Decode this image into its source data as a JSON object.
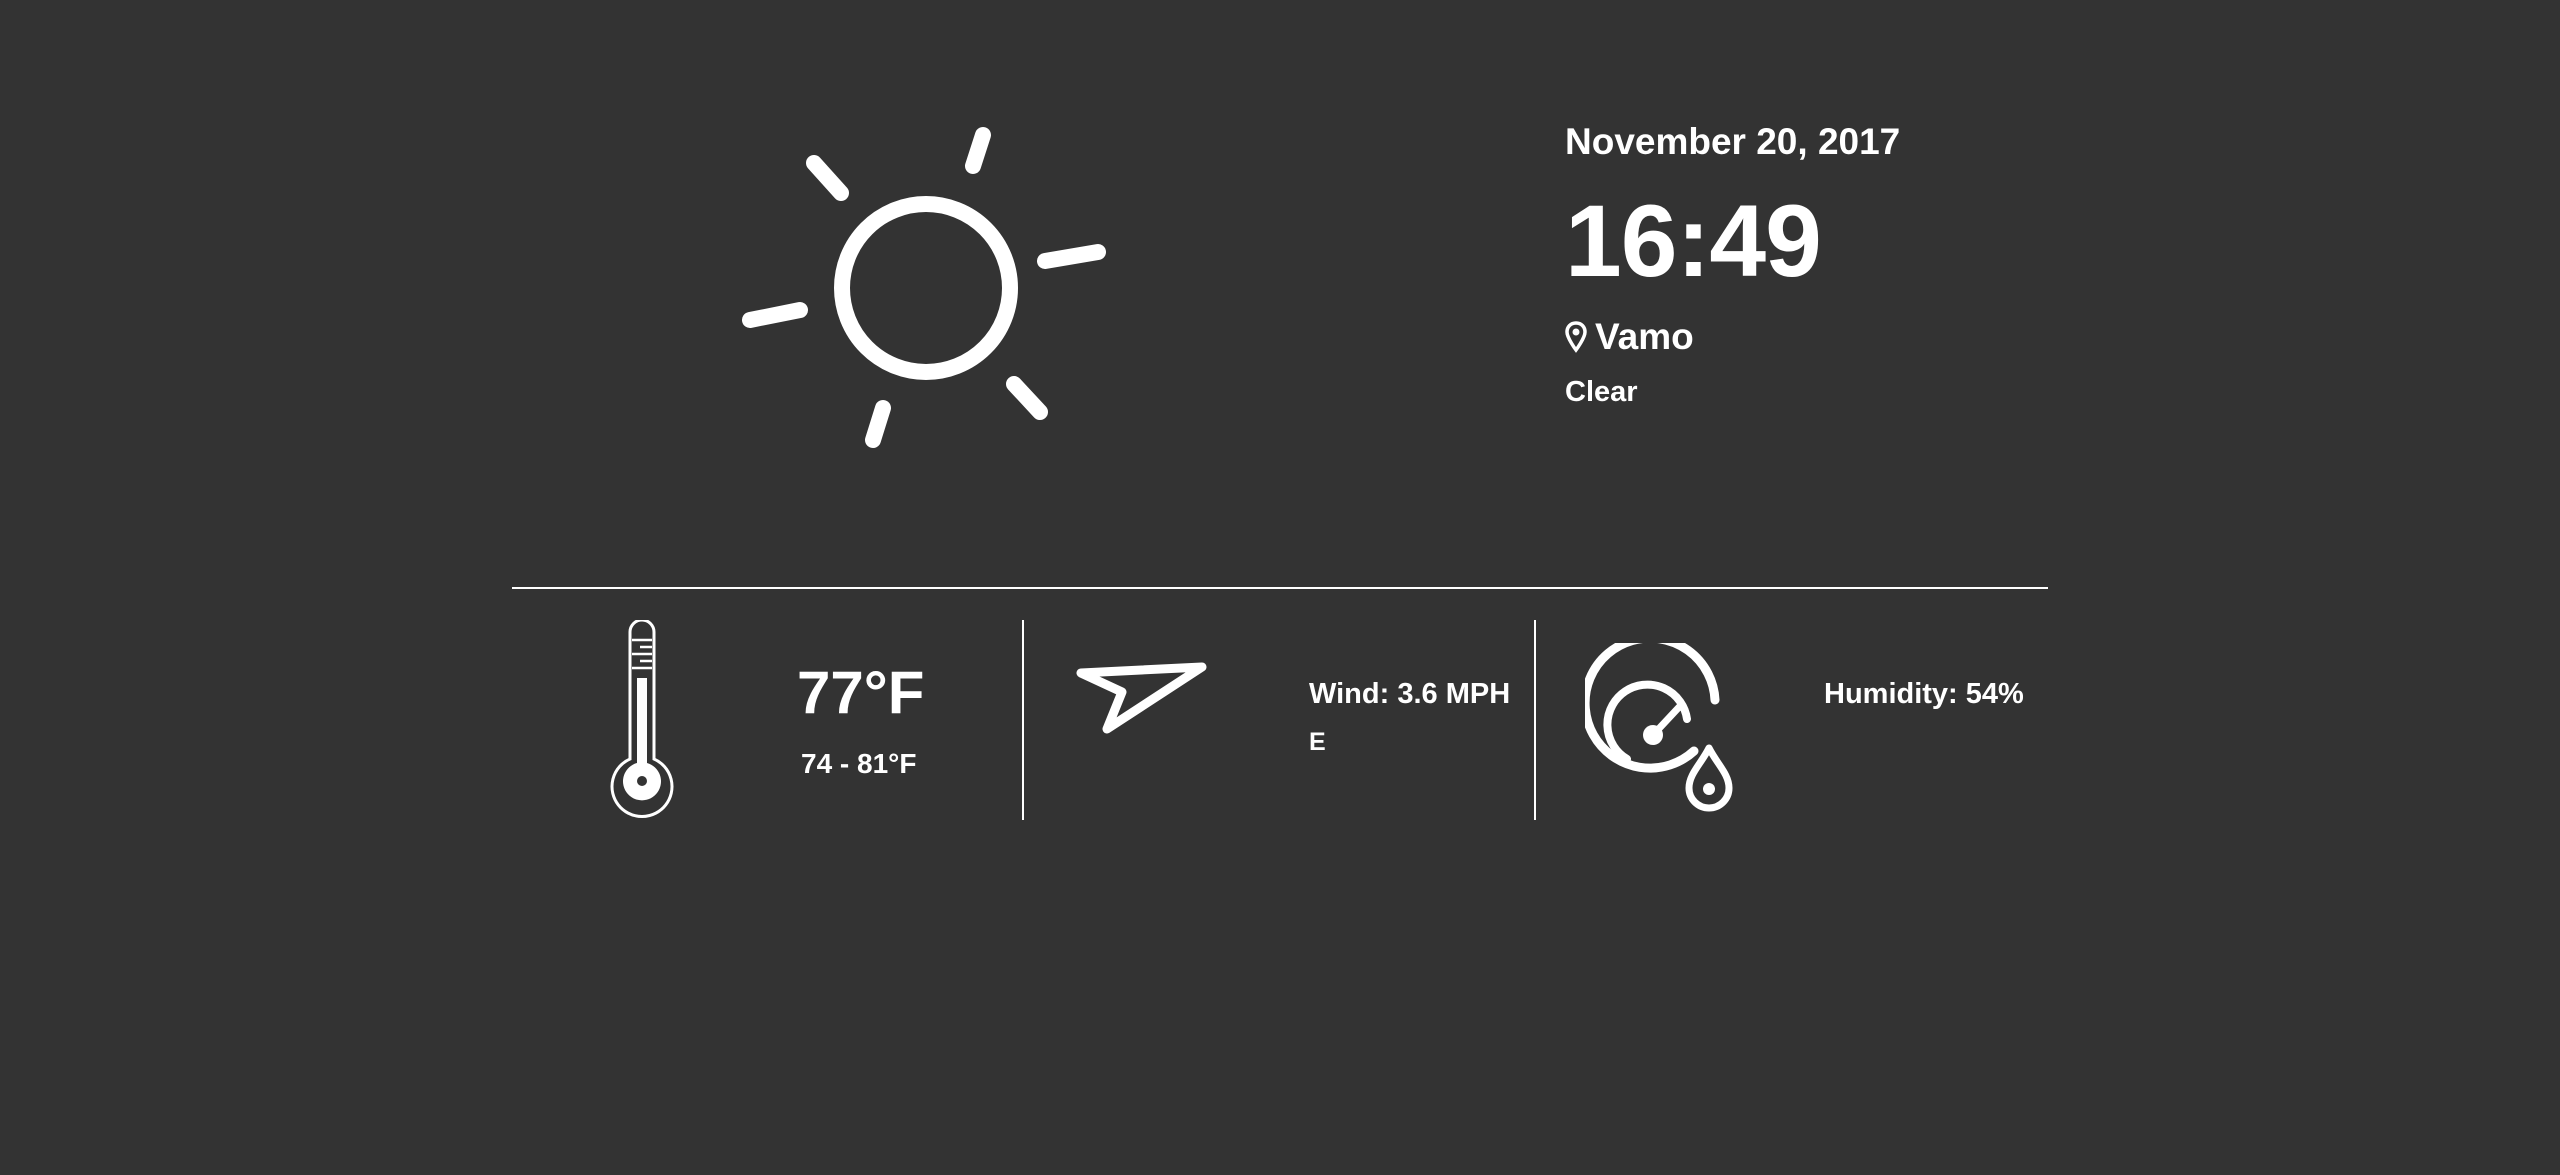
{
  "weather": {
    "icon": "sun-icon",
    "date": "November 20, 2017",
    "time": "16:49",
    "location": "Vamo",
    "condition": "Clear"
  },
  "stats": {
    "temperature": {
      "icon": "thermometer-icon",
      "current": "77°F",
      "range": "74 - 81°F"
    },
    "wind": {
      "icon": "wind-direction-icon",
      "speed": "Wind: 3.6 MPH",
      "direction": "E"
    },
    "humidity": {
      "icon": "humidity-gauge-icon",
      "value": "Humidity: 54%"
    }
  },
  "colors": {
    "background": "#333333",
    "foreground": "#ffffff"
  }
}
